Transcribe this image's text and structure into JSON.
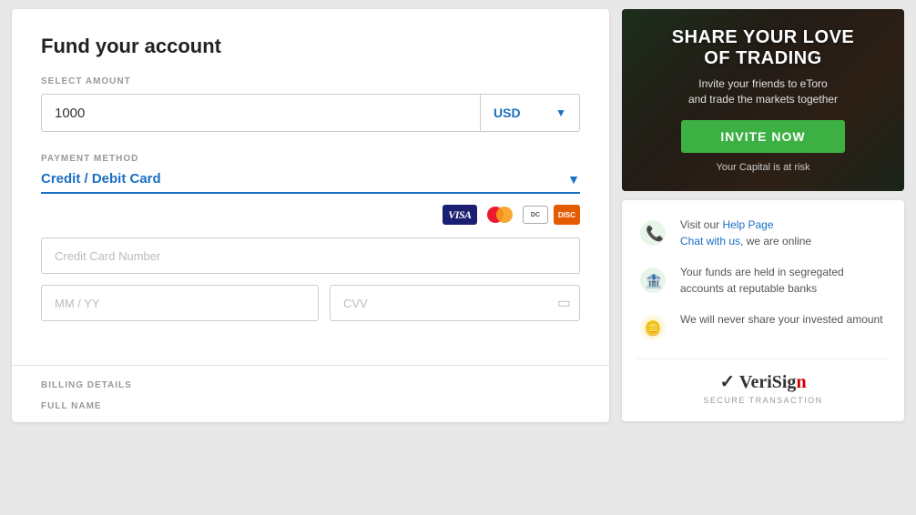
{
  "page": {
    "title": "Fund your account"
  },
  "form": {
    "select_amount_label": "SELECT AMOUNT",
    "amount_value": "1000",
    "currency": "USD",
    "payment_method_label": "PAYMENT METHOD",
    "payment_method_selected": "Credit / Debit Card",
    "credit_card_number_placeholder": "Credit Card Number",
    "expiry_placeholder": "MM / YY",
    "cvv_placeholder": "CVV"
  },
  "billing": {
    "section_label": "BILLING DETAILS",
    "full_name_label": "FULL NAME"
  },
  "promo": {
    "title_line1": "SHARE YOUR LOVE",
    "title_line2": "OF TRADING",
    "subtitle": "Invite your friends to eToro\nand trade the markets together",
    "button_label": "INVITE NOW",
    "risk_text": "Your Capital is at risk"
  },
  "info": {
    "item1_text_prefix": "Visit our ",
    "item1_link1": "Help Page",
    "item1_text_mid": "\nChat with us",
    "item1_text_suffix": ", we are\nonline",
    "item2_text": "Your funds are held in segregated accounts at reputable banks",
    "item3_text": "We will never share your invested amount",
    "verisign_label": "VeriSign",
    "verisign_suffix": "n",
    "secure_label": "SECURE TRANSACTION"
  },
  "colors": {
    "accent": "#1a6fc4",
    "green": "#3cb043",
    "text_dark": "#222",
    "text_muted": "#999"
  }
}
